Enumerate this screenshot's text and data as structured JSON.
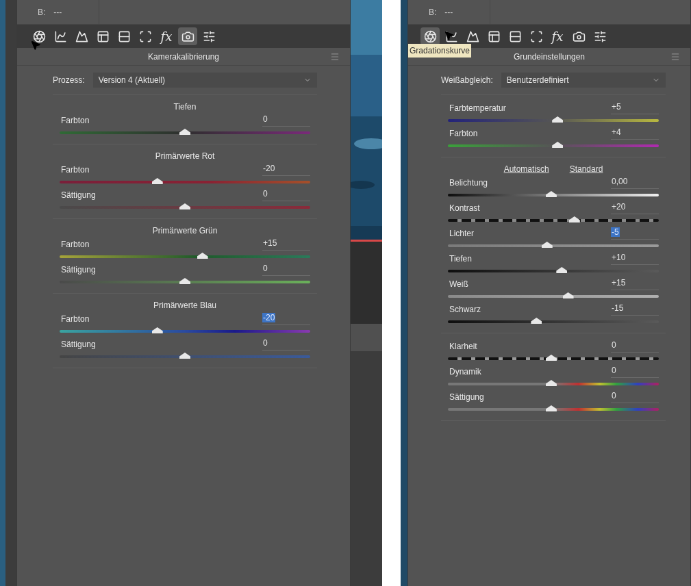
{
  "panels": [
    {
      "header": {
        "label": "B:",
        "value": "---"
      },
      "toolbar": [
        {
          "kind": "aperture",
          "selected": false
        },
        {
          "kind": "curve",
          "selected": false
        },
        {
          "kind": "mountains",
          "selected": false
        },
        {
          "kind": "split",
          "selected": false
        },
        {
          "kind": "bands",
          "selected": false
        },
        {
          "kind": "lens",
          "selected": false
        },
        {
          "kind": "fx",
          "label": "fx",
          "selected": false
        },
        {
          "kind": "camera",
          "selected": true
        },
        {
          "kind": "sliders",
          "selected": false
        }
      ],
      "title": "Kamerakalibrierung",
      "dropdown": {
        "label": "Prozess:",
        "value": "Version 4 (Aktuell)"
      },
      "sections": [
        {
          "heading": "Tiefen",
          "sliders": [
            {
              "label": "Farbton",
              "value": "0",
              "highlighted": false,
              "level": 0.5,
              "kind": "tint"
            }
          ]
        },
        {
          "heading": "Primärwerte Rot",
          "sliders": [
            {
              "label": "Farbton",
              "value": "-20",
              "highlighted": false,
              "level": 0.39,
              "kind": "redhue"
            },
            {
              "label": "Sättigung",
              "value": "0",
              "highlighted": false,
              "level": 0.5,
              "kind": "redsat"
            }
          ]
        },
        {
          "heading": "Primärwerte Grün",
          "sliders": [
            {
              "label": "Farbton",
              "value": "+15",
              "highlighted": false,
              "level": 0.57,
              "kind": "greenhue"
            },
            {
              "label": "Sättigung",
              "value": "0",
              "highlighted": false,
              "level": 0.5,
              "kind": "greensat"
            }
          ]
        },
        {
          "heading": "Primärwerte Blau",
          "sliders": [
            {
              "label": "Farbton",
              "value": "-20",
              "highlighted": true,
              "level": 0.39,
              "kind": "bluehue"
            },
            {
              "label": "Sättigung",
              "value": "0",
              "highlighted": false,
              "level": 0.5,
              "kind": "bluesat"
            }
          ]
        }
      ]
    },
    {
      "header": {
        "label": "B:",
        "value": "---"
      },
      "toolbar": [
        {
          "kind": "aperture",
          "selected": true
        },
        {
          "kind": "curve",
          "selected": false
        },
        {
          "kind": "mountains",
          "selected": false
        },
        {
          "kind": "split",
          "selected": false
        },
        {
          "kind": "bands",
          "selected": false
        },
        {
          "kind": "lens",
          "selected": false
        },
        {
          "kind": "fx",
          "label": "fx",
          "selected": false
        },
        {
          "kind": "camera",
          "selected": false
        },
        {
          "kind": "sliders",
          "selected": false
        }
      ],
      "tooltip": "Gradationskurve",
      "title": "Grundeinstellungen",
      "dropdown": {
        "label": "Weißabgleich:",
        "value": "Benutzerdefiniert"
      },
      "sections": [
        {
          "sliders": [
            {
              "label": "Farbtemperatur",
              "value": "+5",
              "highlighted": false,
              "level": 0.52,
              "kind": "temperature"
            },
            {
              "label": "Farbton",
              "value": "+4",
              "highlighted": false,
              "level": 0.52,
              "kind": "tint2"
            }
          ]
        },
        {
          "links": [
            "Automatisch",
            "Standard"
          ],
          "sliders": [
            {
              "label": "Belichtung",
              "value": "0,00",
              "highlighted": false,
              "level": 0.49,
              "kind": "exposure"
            },
            {
              "label": "Kontrast",
              "value": "+20",
              "highlighted": false,
              "level": 0.6,
              "kind": "contrast"
            },
            {
              "label": "Lichter",
              "value": "-5",
              "highlighted": true,
              "level": 0.47,
              "kind": "highlights"
            },
            {
              "label": "Tiefen",
              "value": "+10",
              "highlighted": false,
              "level": 0.54,
              "kind": "shadows"
            },
            {
              "label": "Weiß",
              "value": "+15",
              "highlighted": false,
              "level": 0.57,
              "kind": "whites"
            },
            {
              "label": "Schwarz",
              "value": "-15",
              "highlighted": false,
              "level": 0.42,
              "kind": "blacks"
            }
          ]
        },
        {
          "sliders": [
            {
              "label": "Klarheit",
              "value": "0",
              "highlighted": false,
              "level": 0.49,
              "kind": "clarity"
            },
            {
              "label": "Dynamik",
              "value": "0",
              "highlighted": false,
              "level": 0.49,
              "kind": "vibrance"
            },
            {
              "label": "Sättigung",
              "value": "0",
              "highlighted": false,
              "level": 0.49,
              "kind": "vibrance"
            }
          ]
        }
      ]
    }
  ]
}
